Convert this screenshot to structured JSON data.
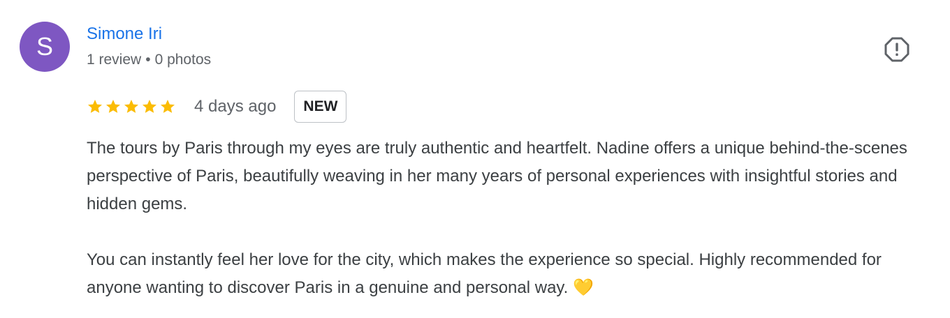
{
  "review": {
    "author": {
      "avatar_letter": "S",
      "avatar_color": "#7e57c2",
      "name": "Simone Iri",
      "review_count": "1 review",
      "separator": "•",
      "photo_count": "0 photos"
    },
    "report_icon": "report-flag-icon",
    "rating": 5,
    "rating_max": 5,
    "star_color": "#fbbc04",
    "date": "4 days ago",
    "badge": "NEW",
    "paragraphs": [
      "The tours by Paris through my eyes are truly authentic and heartfelt. Nadine offers a unique behind-the-scenes perspective of Paris, beautifully weaving in her many years of personal experiences with insightful stories and hidden gems.",
      "You can instantly feel her love for the city, which makes the experience so special. Highly recommended for anyone wanting to discover Paris in a genuine and personal way. 💛"
    ]
  }
}
